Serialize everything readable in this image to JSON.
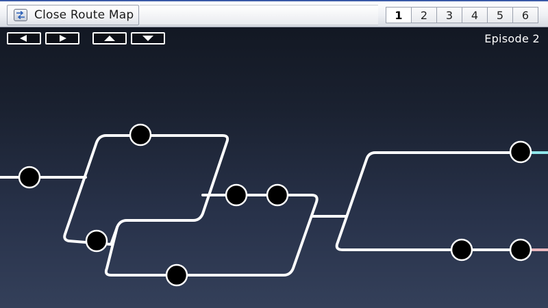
{
  "toolbar": {
    "close_label": "Close Route Map",
    "close_icon": "route-map-icon"
  },
  "pages": {
    "items": [
      "1",
      "2",
      "3",
      "4",
      "5",
      "6"
    ],
    "active": "1"
  },
  "nav": {
    "left_icon": "arrow-left-icon",
    "right_icon": "arrow-right-icon",
    "up_icon": "arrow-up-icon",
    "down_icon": "arrow-down-icon"
  },
  "episode_label": "Episode 2",
  "colors": {
    "route_line": "#ffffff",
    "node_fill": "#000000",
    "node_stroke": "#ffffff",
    "route_cyan": "#8fe6ea",
    "route_pink": "#e8b6be"
  }
}
